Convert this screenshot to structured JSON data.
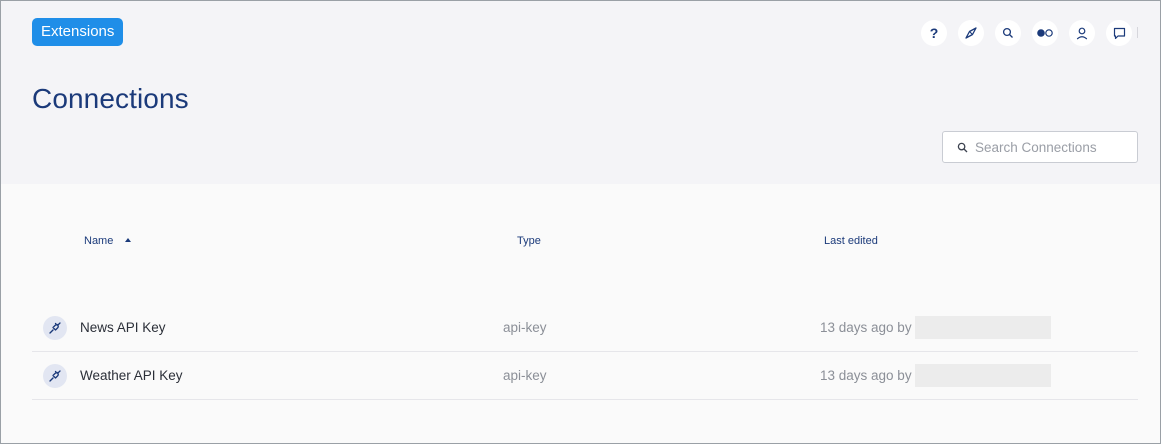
{
  "app": {
    "badge_label": "Extensions"
  },
  "toolbar": {
    "icons": [
      "help-icon",
      "compass-icon",
      "search-icon",
      "toggle-icon",
      "user-icon",
      "chat-icon"
    ]
  },
  "page": {
    "title": "Connections"
  },
  "search": {
    "placeholder": "Search Connections",
    "value": ""
  },
  "table": {
    "columns": {
      "name": "Name",
      "type": "Type",
      "last_edited": "Last edited"
    },
    "sort": {
      "column": "Name",
      "direction": "ascending"
    },
    "rows": [
      {
        "name": "News API Key",
        "type": "api-key",
        "last_edited": "13 days ago by"
      },
      {
        "name": "Weather API Key",
        "type": "api-key",
        "last_edited": "13 days ago by"
      }
    ]
  },
  "colors": {
    "accent": "#1f8ee8",
    "title": "#1b3a7a",
    "header_bg": "#f4f4f7",
    "icon_bg": "#e2e6f2"
  }
}
